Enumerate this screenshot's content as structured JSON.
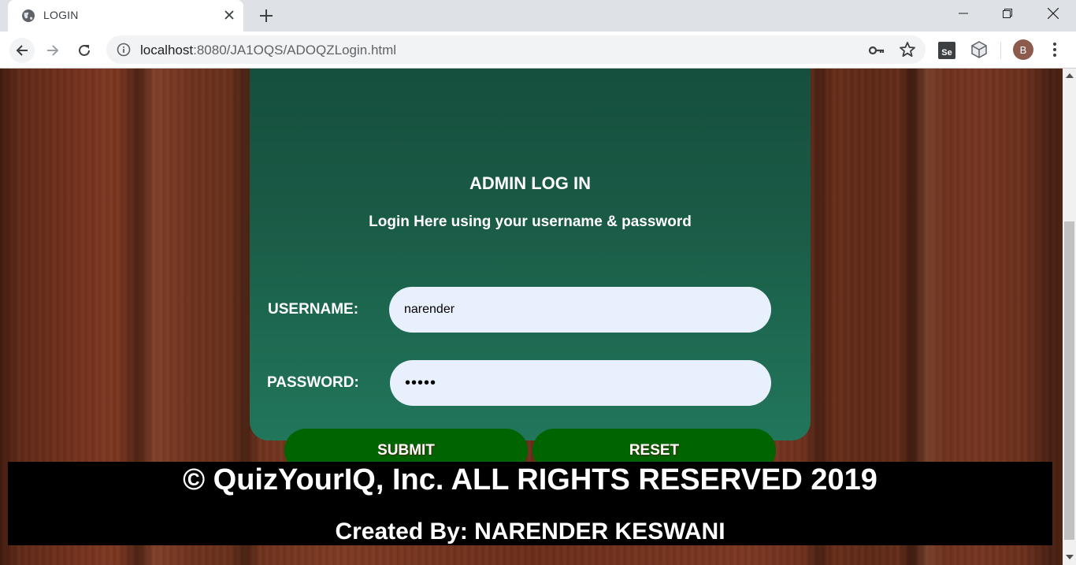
{
  "browser": {
    "tab": {
      "title": "LOGIN",
      "favicon": "globe-icon"
    },
    "url": {
      "host": "localhost",
      "rest": ":8080/JA1OQS/ADOQZLogin.html"
    },
    "profile_initial": "B",
    "icons": {
      "tab_close": "close-icon",
      "new_tab": "plus-icon",
      "back": "arrow-left-icon",
      "forward": "arrow-right-icon",
      "reload": "reload-icon",
      "site_info": "info-icon",
      "passwords": "key-icon",
      "bookmark": "star-icon",
      "ext_selenium": "selenium-icon",
      "ext_cube": "cube-icon",
      "menu": "kebab-menu-icon"
    }
  },
  "login": {
    "title": "ADMIN LOG IN",
    "subtitle": "Login Here using your username & password",
    "username_label": "USERNAME:",
    "username_value": "narender",
    "password_label": "PASSWORD:",
    "password_value": "•••••",
    "submit_label": "SUBMIT",
    "reset_label": "RESET"
  },
  "footer": {
    "copyright": "© QuizYourIQ, Inc. ALL RIGHTS RESERVED 2019",
    "created_by": "Created By: NARENDER KESWANI"
  },
  "colors": {
    "card_top": "#144c3b",
    "card_bottom": "#21765b",
    "button": "#006400",
    "input_bg": "#e8f0fe",
    "footer_bg": "#000000"
  }
}
